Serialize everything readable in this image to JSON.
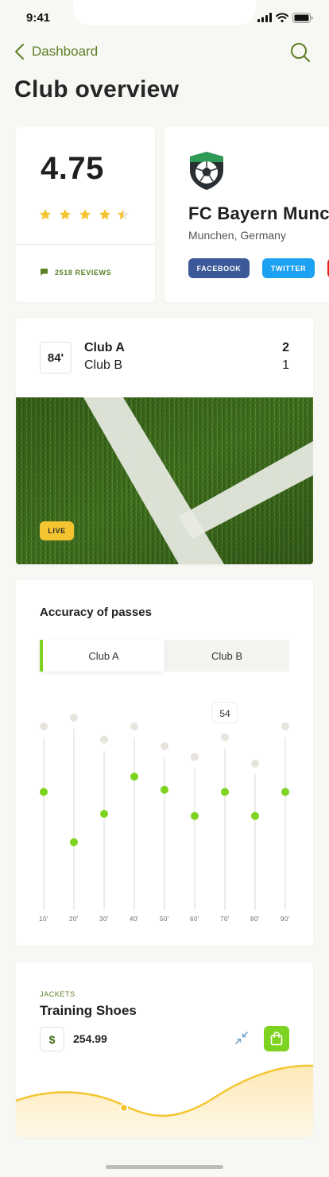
{
  "status": {
    "time": "9:41"
  },
  "nav": {
    "back_label": "Dashboard"
  },
  "page": {
    "title": "Club overview"
  },
  "rating": {
    "value": "4.75",
    "stars": 4.5,
    "reviews_label": "2518 REVIEWS"
  },
  "club": {
    "name": "FC Bayern Munchen",
    "location": "Munchen, Germany",
    "social": [
      {
        "label": "FACEBOOK"
      },
      {
        "label": "TWITTER"
      },
      {
        "label": ""
      }
    ]
  },
  "match": {
    "minute": "84'",
    "team_a": "Club A",
    "team_b": "Club B",
    "score_a": "2",
    "score_b": "1",
    "badge": "LIVE"
  },
  "passes": {
    "title": "Accuracy of passes",
    "tabs": [
      {
        "label": "Club A",
        "active": true
      },
      {
        "label": "Club B",
        "active": false
      }
    ]
  },
  "chart_data": {
    "type": "scatter",
    "title": "Accuracy of passes",
    "categories": [
      "10'",
      "20'",
      "30'",
      "40'",
      "50'",
      "60'",
      "70'",
      "80'",
      "90'"
    ],
    "series": [
      {
        "name": "Club A",
        "values": [
          54,
          31,
          44,
          61,
          55,
          43,
          54,
          43,
          54
        ]
      },
      {
        "values": [
          84,
          88,
          78,
          84,
          75,
          70,
          79,
          67,
          84
        ]
      }
    ],
    "highlight_label": "54",
    "highlight_index": 6,
    "ylim": [
      0,
      100
    ],
    "colors": {
      "selected": "#7ed321",
      "other": "#e6e4dc",
      "stem": "#ecebe6"
    }
  },
  "product": {
    "category": "JACKETS",
    "name": "Training Shoes",
    "currency": "$",
    "price": "254.99"
  },
  "colors": {
    "accent": "#7ed321",
    "accent_dark": "#5d7f25",
    "star": "#f5c531",
    "facebook": "#3b5998",
    "twitter": "#1da1f2",
    "youtube": "#e62117"
  }
}
